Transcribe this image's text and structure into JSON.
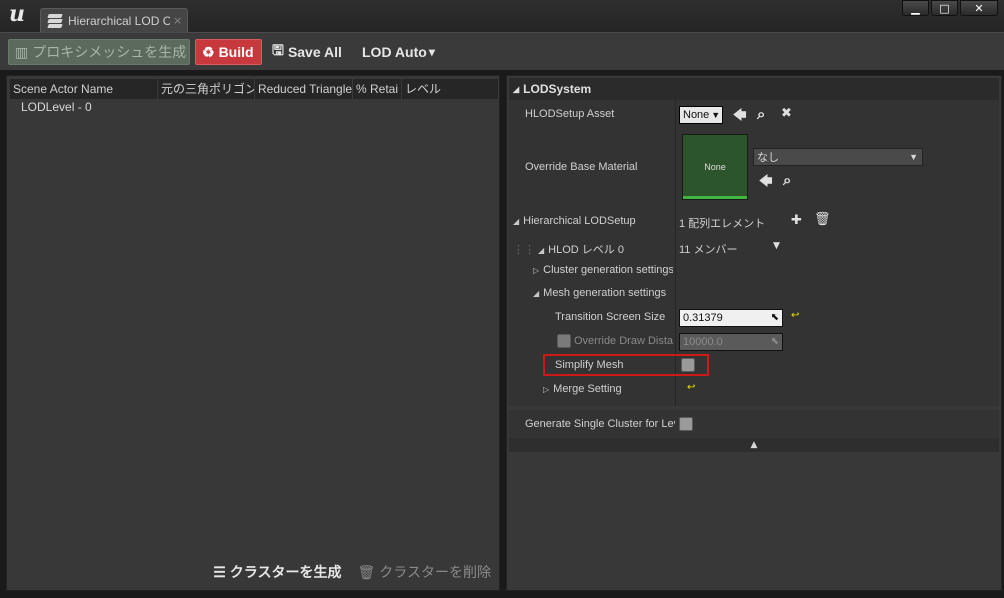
{
  "window": {
    "tab_title": "Hierarchical LOD O",
    "tab_close": "×",
    "buttons": {
      "minimize": "▁",
      "maximize": "□",
      "close": "✕"
    }
  },
  "toolbar": {
    "proxy_label": "プロキシメッシュを生成",
    "build_label": "Build",
    "save_all_label": "Save All",
    "lod_auto_label": "LOD Auto",
    "lod_auto_arrow": "▾"
  },
  "outliner": {
    "columns": [
      "Scene Actor Name",
      "元の三角ポリゴン",
      "Reduced Triangle",
      "% Retai",
      "レベル"
    ],
    "rows": [
      "LODLevel - 0"
    ],
    "generate_clusters_label": "クラスターを生成",
    "delete_clusters_label": "クラスターを削除"
  },
  "details": {
    "section_title": "LODSystem",
    "hlod_setup_asset": {
      "label": "HLODSetup Asset",
      "value": "None"
    },
    "override_base_material": {
      "label": "Override Base Material",
      "thumb_label": "None",
      "combo_value": "なし"
    },
    "hierarchical_lod_setup": {
      "label": "Hierarchical LODSetup",
      "value": "1 配列エレメント"
    },
    "hlod_level": {
      "label": "HLOD レベル 0",
      "value": "11 メンバー"
    },
    "cluster_generation": {
      "label": "Cluster generation settings"
    },
    "mesh_generation": {
      "label": "Mesh generation settings"
    },
    "transition_screen_size": {
      "label": "Transition Screen Size",
      "value": "0.31379"
    },
    "override_draw_distance": {
      "label": "Override Draw Distance",
      "value": "10000.0"
    },
    "simplify_mesh": {
      "label": "Simplify Mesh",
      "checked": false
    },
    "merge_setting": {
      "label": "Merge Setting"
    },
    "generate_single_cluster": {
      "label": "Generate Single Cluster for Level",
      "checked": false
    }
  },
  "colors": {
    "build": "#c8393e",
    "proxy": "#5c6a5c",
    "highlight": "#d01818",
    "reset_arrow": "#e8e000",
    "thumb": "#2c552c"
  },
  "icons": {
    "arrow_left": "🡄",
    "search": "⌕",
    "clear": "✖",
    "add": "✚",
    "delete": "🗑",
    "reset": "↩"
  }
}
